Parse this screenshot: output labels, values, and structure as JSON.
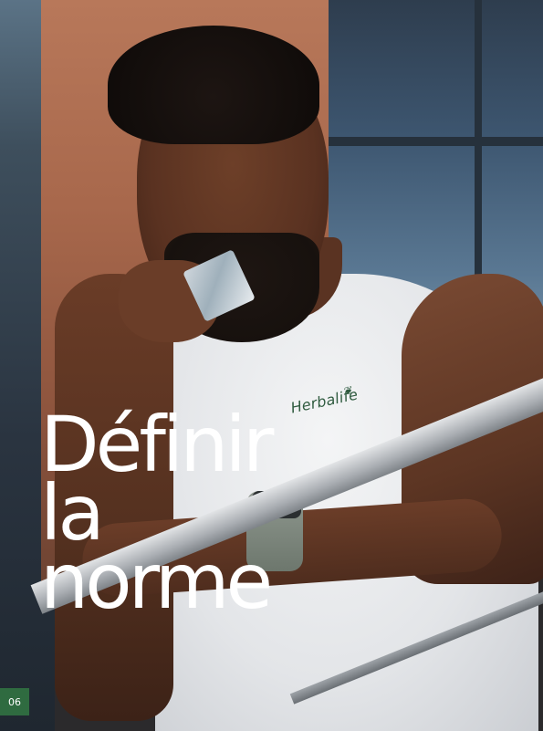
{
  "photo": {
    "shirt_brand": "Herbalife"
  },
  "headline": {
    "lines": [
      "Définir",
      "la",
      "norme"
    ]
  },
  "page_number": "06",
  "colors": {
    "headline": "#ffffff",
    "page_badge": "#2f6b40",
    "brand_green": "#2f5b3f"
  }
}
